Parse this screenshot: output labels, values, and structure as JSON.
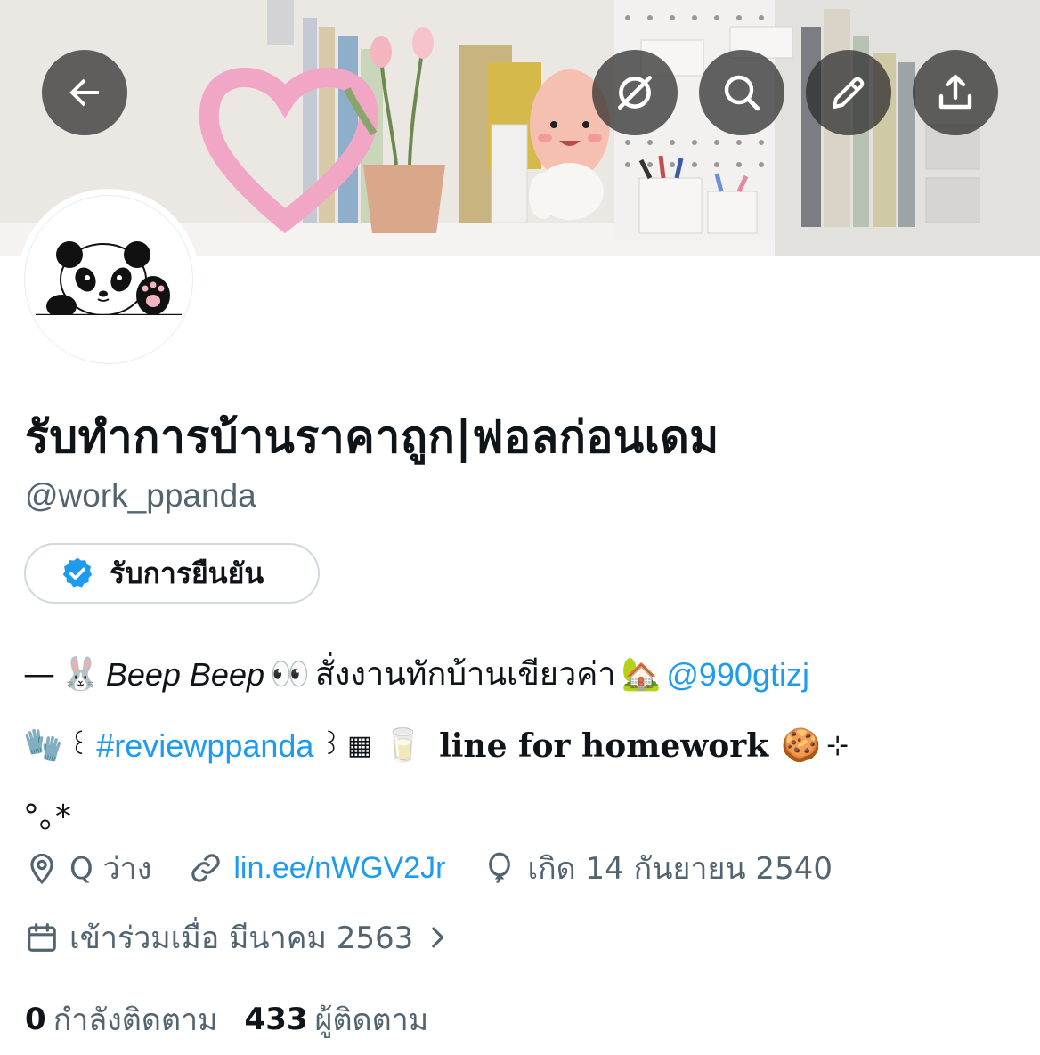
{
  "header": {
    "icons": [
      "back-arrow-icon",
      "hide-icon",
      "search-icon",
      "edit-pencil-icon",
      "share-icon"
    ]
  },
  "profile": {
    "display_name": "รับทำการบ้านราคาถูก|ฟอลก่อนเดม",
    "handle": "@work_ppanda",
    "verify_label": "รับการยืนยัน",
    "bio": {
      "dash": "—",
      "bunny_emoji": "🐰",
      "beep": "Beep Beep",
      "eyes_emoji": "👀",
      "thai_text": "สั่งงานทักบ้านเขียวค่า",
      "house_emoji": "🏡",
      "mention": "@990gtizj",
      "glove_emoji": "🧤",
      "bracket_open": "꒰",
      "hashtag": "#reviewppanda",
      "bracket_close": "꒱",
      "grid_symbol": "▦",
      "milk_emoji": "🥛",
      "line_text": "line for homework",
      "cookie_emoji": "🍪",
      "sparkle": "⊹",
      "tail": "°｡*"
    },
    "location": "Q ว่าง",
    "website": "lin.ee/nWGV2Jr",
    "birthday": "เกิด 14 กันยายน 2540",
    "joined": "เข้าร่วมเมื่อ มีนาคม 2563",
    "following_count": "0",
    "following_label": "กำลังติดตาม",
    "followers_count": "433",
    "followers_label": "ผู้ติดตาม"
  },
  "colors": {
    "link": "#1d9bf0",
    "secondary_text": "#536471",
    "verified_badge": "#1d9bf0"
  }
}
